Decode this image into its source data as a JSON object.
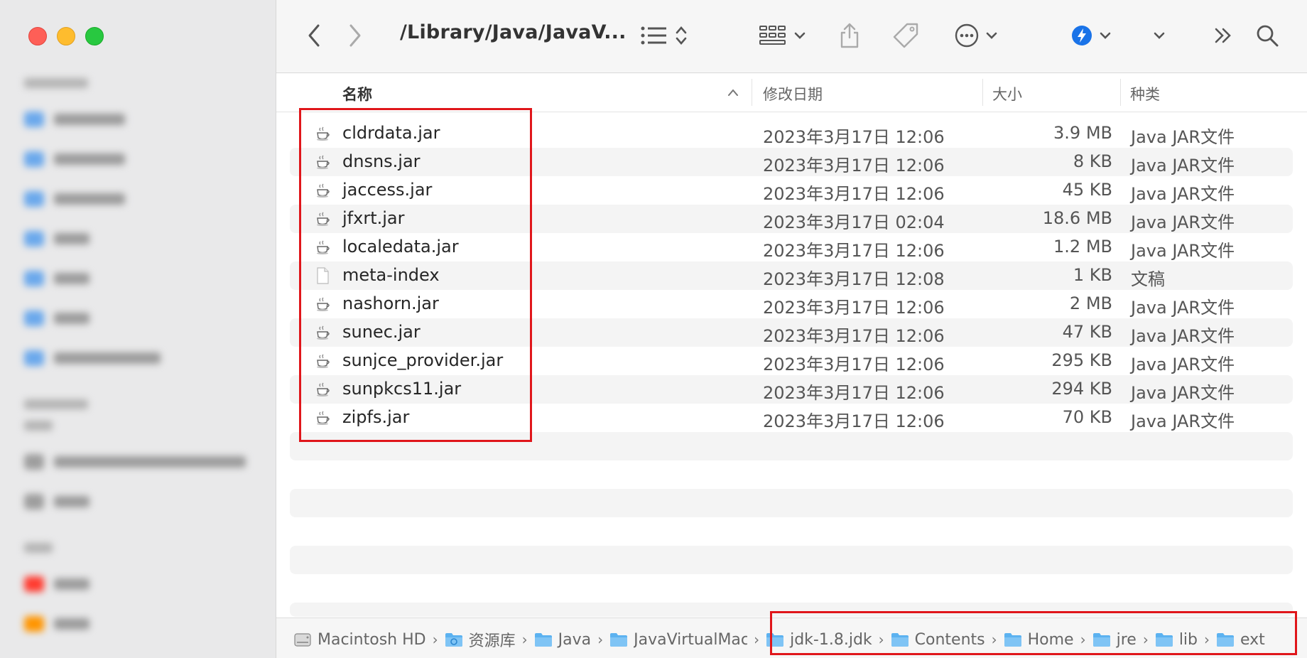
{
  "toolbar": {
    "path_title": "/Library/Java/JavaV..."
  },
  "columns": {
    "name": "名称",
    "date": "修改日期",
    "size": "大小",
    "kind": "种类"
  },
  "files": [
    {
      "name": "cldrdata.jar",
      "date": "2023年3月17日 12:06",
      "size": "3.9 MB",
      "kind": "Java JAR文件",
      "icon": "jar-icon"
    },
    {
      "name": "dnsns.jar",
      "date": "2023年3月17日 12:06",
      "size": "8 KB",
      "kind": "Java JAR文件",
      "icon": "jar-icon"
    },
    {
      "name": "jaccess.jar",
      "date": "2023年3月17日 12:06",
      "size": "45 KB",
      "kind": "Java JAR文件",
      "icon": "jar-icon"
    },
    {
      "name": "jfxrt.jar",
      "date": "2023年3月17日 02:04",
      "size": "18.6 MB",
      "kind": "Java JAR文件",
      "icon": "jar-icon"
    },
    {
      "name": "localedata.jar",
      "date": "2023年3月17日 12:06",
      "size": "1.2 MB",
      "kind": "Java JAR文件",
      "icon": "jar-icon"
    },
    {
      "name": "meta-index",
      "date": "2023年3月17日 12:08",
      "size": "1 KB",
      "kind": "文稿",
      "icon": "document-icon"
    },
    {
      "name": "nashorn.jar",
      "date": "2023年3月17日 12:06",
      "size": "2 MB",
      "kind": "Java JAR文件",
      "icon": "jar-icon"
    },
    {
      "name": "sunec.jar",
      "date": "2023年3月17日 12:06",
      "size": "47 KB",
      "kind": "Java JAR文件",
      "icon": "jar-icon"
    },
    {
      "name": "sunjce_provider.jar",
      "date": "2023年3月17日 12:06",
      "size": "295 KB",
      "kind": "Java JAR文件",
      "icon": "jar-icon"
    },
    {
      "name": "sunpkcs11.jar",
      "date": "2023年3月17日 12:06",
      "size": "294 KB",
      "kind": "Java JAR文件",
      "icon": "jar-icon"
    },
    {
      "name": "zipfs.jar",
      "date": "2023年3月17日 12:06",
      "size": "70 KB",
      "kind": "Java JAR文件",
      "icon": "jar-icon"
    }
  ],
  "pathbar": [
    {
      "label": "Macintosh HD",
      "icon": "hard-drive-icon"
    },
    {
      "label": "资源库",
      "icon": "library-folder-icon"
    },
    {
      "label": "Java",
      "icon": "folder-icon"
    },
    {
      "label": "JavaVirtualMac",
      "icon": "folder-icon"
    },
    {
      "label": "jdk-1.8.jdk",
      "icon": "folder-icon"
    },
    {
      "label": "Contents",
      "icon": "folder-icon"
    },
    {
      "label": "Home",
      "icon": "folder-icon"
    },
    {
      "label": "jre",
      "icon": "folder-icon"
    },
    {
      "label": "lib",
      "icon": "folder-icon"
    },
    {
      "label": "ext",
      "icon": "folder-icon"
    }
  ],
  "colors": {
    "highlight": "#e0161b",
    "folder_blue": "#5cb2f0",
    "airdrop_blue": "#1a73e8"
  }
}
